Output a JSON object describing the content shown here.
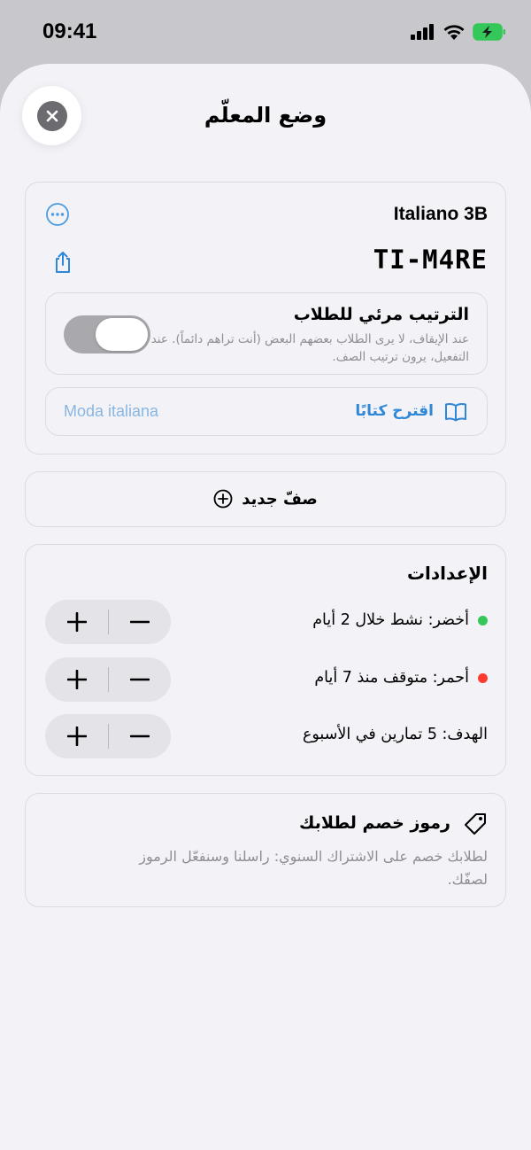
{
  "status": {
    "time": "09:41"
  },
  "sheet": {
    "title": "وضع المعلّم"
  },
  "class_card": {
    "name": "Italiano 3B",
    "code": "TI-M4RE",
    "toggle": {
      "title": "الترتيب مرئي للطلاب",
      "description": "عند الإيقاف، لا يرى الطلاب بعضهم البعض (أنت تراهم دائماً). عند التفعيل، يرون ترتيب الصف.",
      "state": "on"
    },
    "book": {
      "label": "اقترح كتابًا",
      "value": "Moda italiana"
    }
  },
  "new_class": {
    "label": "صفّ جديد"
  },
  "settings": {
    "title": "الإعدادات",
    "rows": [
      {
        "label": "أخضر: نشط خلال 2 أيام",
        "dot_color": "#34c759"
      },
      {
        "label": "أحمر: متوقف منذ 7 أيام",
        "dot_color": "#ff3b30"
      },
      {
        "label": "الهدف: 5 تمارين في الأسبوع",
        "dot_color": ""
      }
    ]
  },
  "discount": {
    "title": "رموز خصم لطلابك",
    "description": "لطلابك خصم على الاشتراك السنوي: راسلنا وسنفعّل الرموز لصفّك."
  },
  "colors": {
    "accent": "#2f87d8",
    "background": "#f2f2f7"
  }
}
